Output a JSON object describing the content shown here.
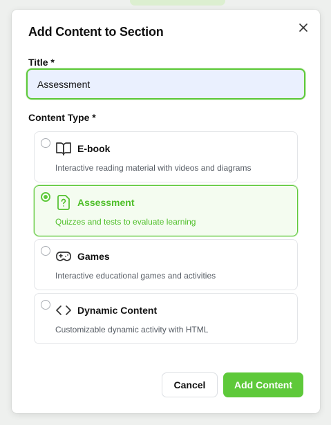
{
  "dialog": {
    "title": "Add Content to Section",
    "close_icon": "close-icon"
  },
  "title_field": {
    "label": "Title *",
    "value": "Assessment"
  },
  "content_type": {
    "label": "Content Type *",
    "selected": "assessment",
    "options": [
      {
        "id": "ebook",
        "icon": "book-open-icon",
        "title": "E-book",
        "description": "Interactive reading material with videos and diagrams"
      },
      {
        "id": "assessment",
        "icon": "file-question-icon",
        "title": "Assessment",
        "description": "Quizzes and tests to evaluate learning"
      },
      {
        "id": "games",
        "icon": "gamepad-icon",
        "title": "Games",
        "description": "Interactive educational games and activities"
      },
      {
        "id": "dynamic",
        "icon": "code-icon",
        "title": "Dynamic Content",
        "description": "Customizable dynamic activity with HTML"
      }
    ]
  },
  "actions": {
    "cancel_label": "Cancel",
    "add_label": "Add Content"
  },
  "colors": {
    "accent": "#5ec93a",
    "input_bg": "#eaf0fe",
    "text": "#111111",
    "muted": "#555b63"
  }
}
